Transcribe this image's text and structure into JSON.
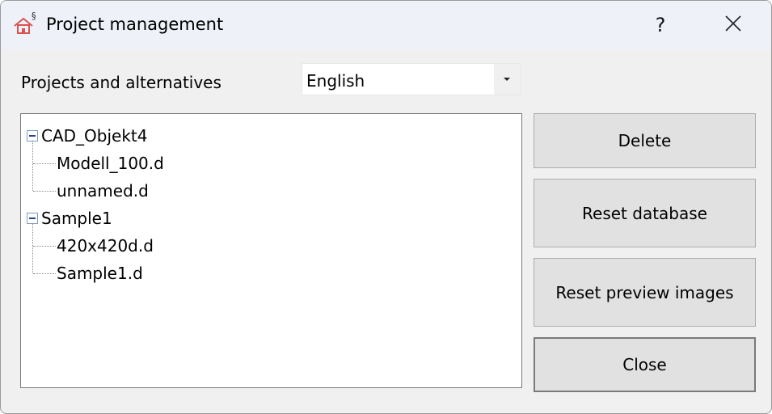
{
  "window": {
    "title": "Project management",
    "help_label": "?"
  },
  "projects_label": "Projects and alternatives",
  "language": {
    "selected": "English"
  },
  "tree": {
    "projects": [
      {
        "name": "CAD_Objekt4",
        "children": [
          "Modell_100.d",
          "unnamed.d"
        ]
      },
      {
        "name": "Sample1",
        "children": [
          "420x420d.d",
          "Sample1.d"
        ]
      }
    ]
  },
  "buttons": {
    "delete": "Delete",
    "reset_database": "Reset database",
    "reset_preview": "Reset preview images",
    "close": "Close"
  },
  "icons": {
    "app": "house-icon",
    "help": "help-icon",
    "close": "close-icon",
    "dropdown": "chevron-down-icon",
    "collapse": "collapse-icon"
  },
  "colors": {
    "titlebar": "#eef2f8",
    "dialog_bg": "#f0f0f0",
    "button_bg": "#e1e1e1",
    "app_icon": "#d9534f"
  }
}
